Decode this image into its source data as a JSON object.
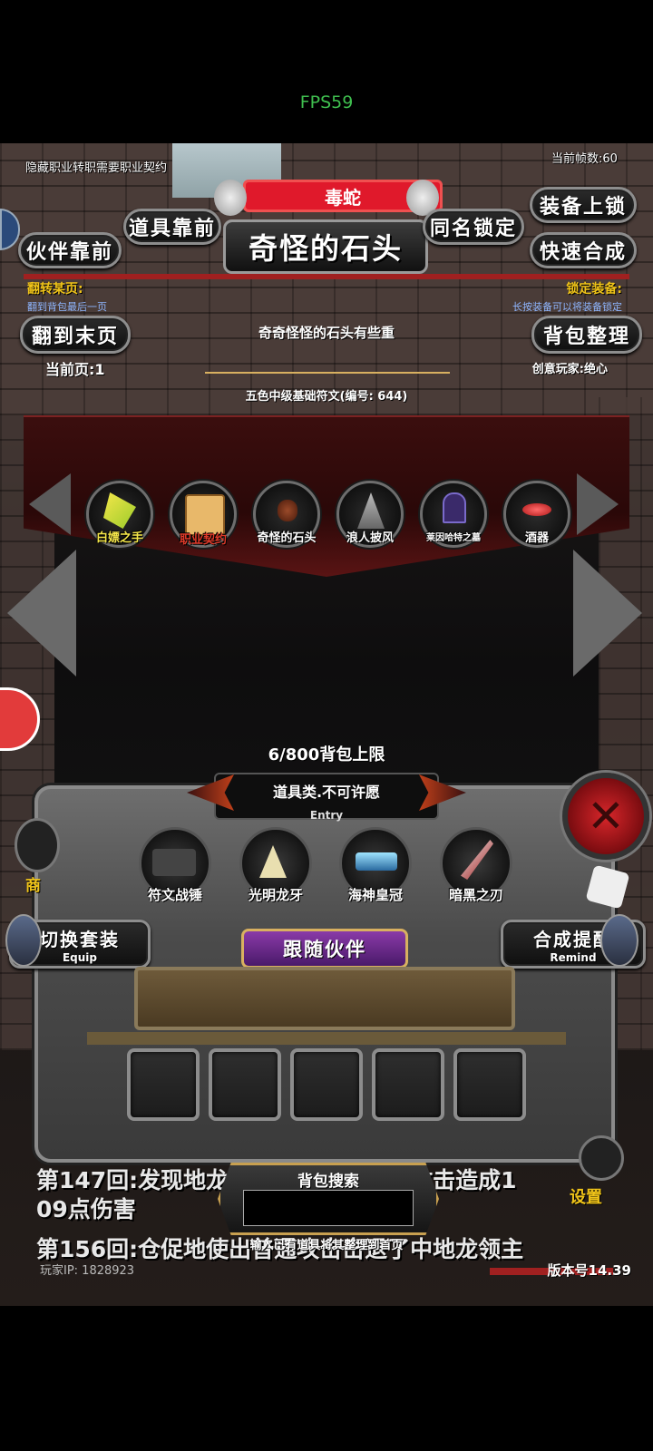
{
  "status_bar": {
    "fps": "FPS59"
  },
  "header": {
    "notice": "隐藏职业转职需要职业契约",
    "frame_count": "当前帧数:60",
    "pet_name": "毒蛇",
    "item_title": "奇怪的石头"
  },
  "buttons": {
    "items_first": "道具靠前",
    "partners_first": "伙伴靠前",
    "same_name_lock": "同名锁定",
    "equip_lock": "装备上锁",
    "quick_merge": "快速合成",
    "jump_last": "翻到末页",
    "bag_sort": "背包整理",
    "switch_set": "切换套装",
    "switch_set_sub": "Equip",
    "merge_remind": "合成提醒",
    "merge_remind_sub": "Remind",
    "follow_partner": "跟随伙伴"
  },
  "hints": {
    "flip_title": "翻转某页:",
    "flip_desc": "翻到背包最后一页",
    "lock_title": "锁定装备:",
    "lock_desc": "长按装备可以将装备锁定",
    "current_page": "当前页:1",
    "creator": "创意玩家:绝心"
  },
  "item_detail": {
    "description": "奇奇怪怪的石头有些重",
    "source": "五色中级基础符文(编号: 644)"
  },
  "bag_items": [
    {
      "label": "白嫖之手",
      "color": "#f5e74a"
    },
    {
      "label": "职业契约",
      "color": "#e03a2a"
    },
    {
      "label": "奇怪的石头",
      "color": "#ffffff"
    },
    {
      "label": "浪人披风",
      "color": "#ffffff"
    },
    {
      "label": "莱因哈特之墓",
      "color": "#ffffff"
    },
    {
      "label": "酒器",
      "color": "#ffffff"
    }
  ],
  "bag_capacity": "6/800背包上限",
  "category": {
    "label": "道具类.不可许愿",
    "sub": "Entry"
  },
  "equipment": [
    {
      "label": "符文战锤"
    },
    {
      "label": "光明龙牙"
    },
    {
      "label": "海神皇冠"
    },
    {
      "label": "暗黑之刃"
    }
  ],
  "side": {
    "shop": "商",
    "settings": "设置"
  },
  "battle_log": {
    "line1": "第147回:发现地龙领主时，使用普通攻击造成1",
    "line2": "09点伤害",
    "line3": "第156回:仓促地使出普通攻击击退了中地龙领主"
  },
  "search": {
    "title": "背包搜索",
    "hint": "输入已有道具将其整理到首页",
    "value": ""
  },
  "footer": {
    "player_ip": "玩家IP: 1828923",
    "version": "版本号14.39"
  },
  "colors": {
    "banner_red": "#e0192b",
    "accent_yellow": "#f0c419",
    "hint_blue": "#8fb6ff"
  }
}
